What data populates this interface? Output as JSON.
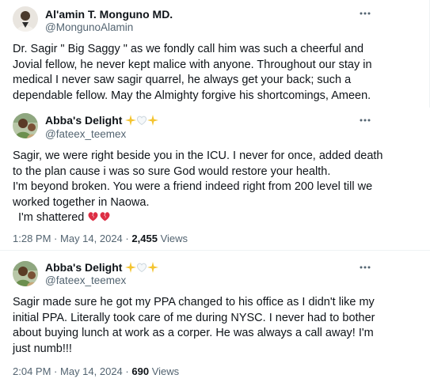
{
  "tweets": [
    {
      "display_name": "Al'amin T. Monguno MD.",
      "handle": "@MongunoAlamin",
      "text_lines": [
        "Dr. Sagir \" Big Saggy \" as we fondly call him was such a cheerful and",
        "Jovial fellow, he never kept malice with anyone. Throughout our stay in",
        "medical I never saw sagir quarrel, he always get your back; such a",
        "dependable fellow. May the Almighty forgive his shortcomings, Ameen."
      ]
    },
    {
      "display_name": "Abba's Delight",
      "handle": "@fateex_teemex",
      "text_lines": [
        "Sagir, we were right beside you in the ICU. I never for once, added death",
        "to the plan cause i was so sure God would restore your health.",
        "I'm beyond broken. You were a friend indeed right from 200 level till we",
        "worked together in Naowa."
      ],
      "last_line_text": "I'm shattered",
      "time": "1:28 PM",
      "date": "May 14, 2024",
      "separator": "·",
      "views_count": "2,455",
      "views_label": "Views"
    },
    {
      "display_name": "Abba's Delight",
      "handle": "@fateex_teemex",
      "text_lines": [
        "Sagir made sure he got my PPA changed to his office as I didn't like my",
        "initial PPA. Literally took care of me during NYSC. I never had to bother",
        "about buying lunch at work as a corper. He was always a call away! I'm",
        "just numb!!!"
      ],
      "time": "2:04 PM",
      "date": "May 14, 2024",
      "separator": "·",
      "views_count": "690",
      "views_label": "Views"
    }
  ],
  "icons": {
    "more": "more-horizontal-icon",
    "sparkles": "sparkles-emoji",
    "white_heart": "white-heart-emoji",
    "broken_heart": "broken-heart-emoji"
  },
  "colors": {
    "text": "#0f1419",
    "secondary": "#536471",
    "divider": "#eff3f4",
    "sparkle": "#f4c430",
    "broken_heart": "#dd2e44"
  }
}
